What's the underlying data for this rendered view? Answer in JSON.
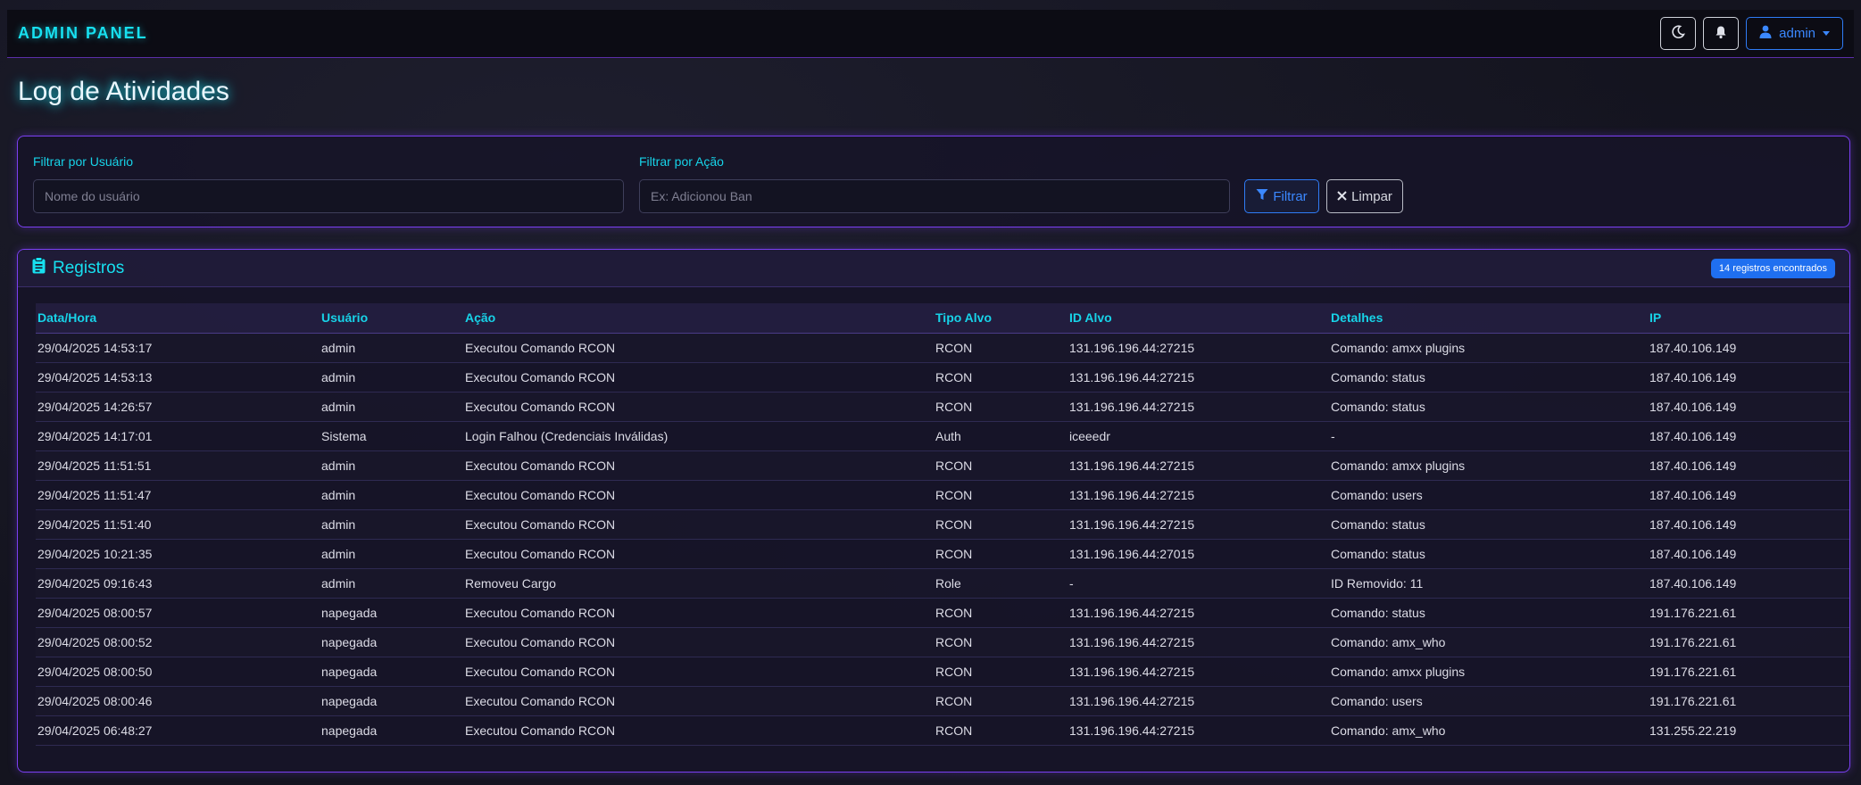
{
  "navbar": {
    "brand": "ADMIN PANEL",
    "user_label": "admin"
  },
  "page": {
    "title": "Log de Atividades"
  },
  "filters": {
    "user_label": "Filtrar por Usuário",
    "user_placeholder": "Nome do usuário",
    "action_label": "Filtrar por Ação",
    "action_placeholder": "Ex: Adicionou Ban",
    "filter_button": "Filtrar",
    "clear_button": "Limpar"
  },
  "records": {
    "title": "Registros",
    "count_badge": "14 registros encontrados",
    "columns": [
      "Data/Hora",
      "Usuário",
      "Ação",
      "Tipo Alvo",
      "ID Alvo",
      "Detalhes",
      "IP"
    ],
    "rows": [
      [
        "29/04/2025 14:53:17",
        "admin",
        "Executou Comando RCON",
        "RCON",
        "131.196.196.44:27215",
        "Comando: amxx plugins",
        "187.40.106.149"
      ],
      [
        "29/04/2025 14:53:13",
        "admin",
        "Executou Comando RCON",
        "RCON",
        "131.196.196.44:27215",
        "Comando: status",
        "187.40.106.149"
      ],
      [
        "29/04/2025 14:26:57",
        "admin",
        "Executou Comando RCON",
        "RCON",
        "131.196.196.44:27215",
        "Comando: status",
        "187.40.106.149"
      ],
      [
        "29/04/2025 14:17:01",
        "Sistema",
        "Login Falhou (Credenciais Inválidas)",
        "Auth",
        "iceeedr",
        "-",
        "187.40.106.149"
      ],
      [
        "29/04/2025 11:51:51",
        "admin",
        "Executou Comando RCON",
        "RCON",
        "131.196.196.44:27215",
        "Comando: amxx plugins",
        "187.40.106.149"
      ],
      [
        "29/04/2025 11:51:47",
        "admin",
        "Executou Comando RCON",
        "RCON",
        "131.196.196.44:27215",
        "Comando: users",
        "187.40.106.149"
      ],
      [
        "29/04/2025 11:51:40",
        "admin",
        "Executou Comando RCON",
        "RCON",
        "131.196.196.44:27215",
        "Comando: status",
        "187.40.106.149"
      ],
      [
        "29/04/2025 10:21:35",
        "admin",
        "Executou Comando RCON",
        "RCON",
        "131.196.196.44:27015",
        "Comando: status",
        "187.40.106.149"
      ],
      [
        "29/04/2025 09:16:43",
        "admin",
        "Removeu Cargo",
        "Role",
        "-",
        "ID Removido: 11",
        "187.40.106.149"
      ],
      [
        "29/04/2025 08:00:57",
        "napegada",
        "Executou Comando RCON",
        "RCON",
        "131.196.196.44:27215",
        "Comando: status",
        "191.176.221.61"
      ],
      [
        "29/04/2025 08:00:52",
        "napegada",
        "Executou Comando RCON",
        "RCON",
        "131.196.196.44:27215",
        "Comando: amx_who",
        "191.176.221.61"
      ],
      [
        "29/04/2025 08:00:50",
        "napegada",
        "Executou Comando RCON",
        "RCON",
        "131.196.196.44:27215",
        "Comando: amxx plugins",
        "191.176.221.61"
      ],
      [
        "29/04/2025 08:00:46",
        "napegada",
        "Executou Comando RCON",
        "RCON",
        "131.196.196.44:27215",
        "Comando: users",
        "191.176.221.61"
      ],
      [
        "29/04/2025 06:48:27",
        "napegada",
        "Executou Comando RCON",
        "RCON",
        "131.196.196.44:27215",
        "Comando: amx_who",
        "131.255.22.219"
      ]
    ]
  }
}
